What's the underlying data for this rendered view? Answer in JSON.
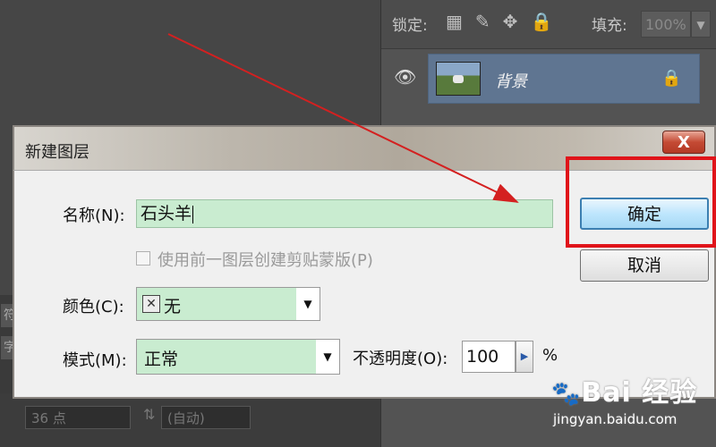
{
  "workspace": {
    "side_glyphs": [
      "符",
      "字"
    ],
    "font_size_value": "36 点",
    "leading_value": "(自动)"
  },
  "layers_panel": {
    "lock_label": "锁定:",
    "fill_label": "填充:",
    "fill_value": "100%",
    "layer": {
      "name": "背景"
    }
  },
  "dialog": {
    "title": "新建图层",
    "close_label": "X",
    "name_label": "名称(N):",
    "name_value": "石头羊",
    "clip_label": "使用前一图层创建剪贴蒙版(P)",
    "color_label": "颜色(C):",
    "color_value": "无",
    "mode_label": "模式(M):",
    "mode_value": "正常",
    "opacity_label": "不透明度(O):",
    "opacity_value": "100",
    "opacity_unit": "%",
    "ok_label": "确定",
    "cancel_label": "取消"
  },
  "watermark": {
    "brand": "Bai 经验",
    "url": "jingyan.baidu.com"
  },
  "colors": {
    "highlight": "#e0141a",
    "arrow": "#d42020",
    "field_fill": "#c9ecd0"
  }
}
